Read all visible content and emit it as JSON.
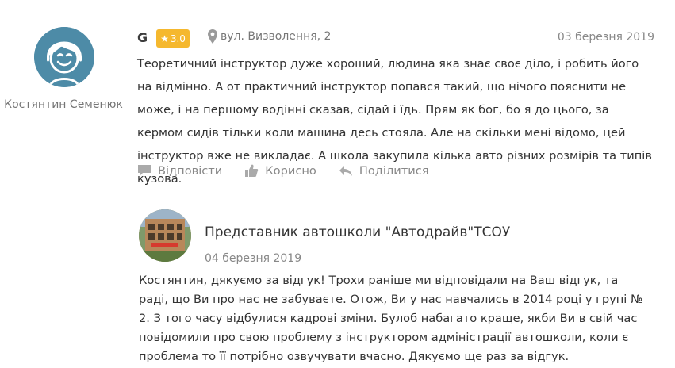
{
  "review": {
    "author_name": "Костянтин Семенюк",
    "source_icon": "google-g-icon",
    "source_letter": "G",
    "rating": "3.0",
    "location": "вул. Визволення, 2",
    "date": "03 березня 2019",
    "text": "Теоретичний інструктор дуже хороший, людина яка знає своє діло, і робить його на відмінно. А от практичний інструктор попався такий, що нічого пояснити не може, і на першому водінні сказав, сідай і їдь. Прям як бог, бо я до цього, за кермом сидів тільки коли машина десь стояла. Але на скільки мені відомо, цей інструктор вже не викладає. А школа закупила кілька авто різних розмірів та типів кузова.",
    "actions": {
      "reply": "Відповісти",
      "useful": "Корисно",
      "share": "Поділитися"
    }
  },
  "response": {
    "author": "Представник автошколи \"Автодрайв\"ТСОУ",
    "date": "04 березня 2019",
    "text": " Костянтин, дякуємо за відгук! Трохи раніше ми відповідали на Ваш відгук, та раді, що Ви про нас не забуваєте. Отож, Ви у нас навчались в 2014 році у групі № 2. З того часу відбулися кадрові зміни. Булоб набагато краще, якби Ви в свій час повідомили про свою проблему з інструктором адміністрації автошколи, коли є проблема то її потрібно озвучувати вчасно. Дякуємо ще раз за відгук."
  },
  "colors": {
    "rating_badge": "#f5b82e",
    "avatar_bg": "#4d8ba7",
    "muted_text": "#888888",
    "body_text": "#333333"
  }
}
